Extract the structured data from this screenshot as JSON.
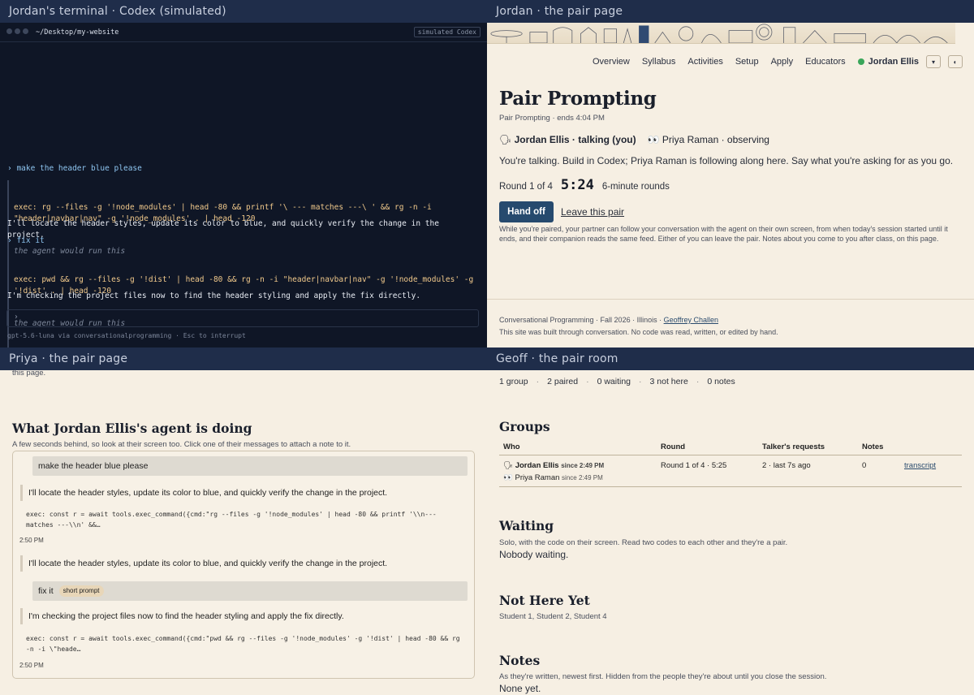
{
  "terminal": {
    "window_title": "Jordan's terminal · Codex (simulated)",
    "path": "~/Desktop/my-website",
    "badge": "simulated Codex",
    "lines": [
      {
        "kind": "prompt",
        "text": "› make the header blue please"
      },
      {
        "kind": "exec",
        "cmd": "exec: rg --files -g '!node_modules' | head -80 && printf '\\ --- matches ---\\ ' && rg -n -i \"header|navbar|nav\" -g '!node_modules' . | head -120",
        "note": "the agent would run this"
      },
      {
        "kind": "say",
        "text": "I'll locate the header styles, update its color to blue, and quickly verify the change in the project."
      },
      {
        "kind": "prompt",
        "text": "› fix it"
      },
      {
        "kind": "exec",
        "cmd": "exec: pwd && rg --files -g '!dist' | head -80 && rg -n -i \"header|navbar|nav\" -g '!node_modules' -g '!dist' . | head -120",
        "note": "the agent would run this"
      },
      {
        "kind": "say",
        "text": "I'm checking the project files now to find the header styling and apply the fix directly."
      }
    ],
    "input_prompt": "›",
    "status": "gpt-5.6-luna via conversationalprogramming  ·  Esc to interrupt"
  },
  "jordan_page": {
    "window_title": "Jordan · the pair page",
    "nav": [
      "Overview",
      "Syllabus",
      "Activities",
      "Setup",
      "Apply",
      "Educators"
    ],
    "user_name": "Jordan Ellis",
    "title": "Pair Prompting",
    "subtitle": "Pair Prompting · ends 4:04 PM",
    "talker": "Jordan Ellis · talking (you)",
    "observer": "Priya Raman · observing",
    "instruction": "You're talking. Build in Codex; Priya Raman is following along here. Say what you're asking for as you go.",
    "round_label": "Round 1 of 4",
    "timer": "5:24",
    "round_length": "6-minute rounds",
    "handoff_label": "Hand off",
    "leave_label": "Leave this pair",
    "fine_print": "While you're paired, your partner can follow your conversation with the agent on their own screen, from when today's session started until it ends, and their companion reads the same feed. Either of you can leave the pair. Notes about you come to you after class, on this page.",
    "footer_course": "Conversational Programming  ·  Fall 2026  ·  Illinois  ·",
    "footer_author": "Geoffrey Challen",
    "footer_note": "This site was built through conversation. No code was read, written, or edited by hand."
  },
  "priya_page": {
    "window_title": "Priya · the pair page",
    "cut_text": "this page.",
    "heading": "What Jordan Ellis's agent is doing",
    "subheading": "A few seconds behind, so look at their screen too. Click one of their messages to attach a note to it.",
    "feed": {
      "user_msg_1": "make the header blue please",
      "agent_msg_1": "I'll locate the header styles, update its color to blue, and quickly verify the change in the project.",
      "code_1": "exec: const r = await tools.exec_command({cmd:\"rg --files -g '!node_modules' | head -80 && printf '\\\\n---\nmatches ---\\\\n' &&…",
      "time_1": "2:50 PM",
      "agent_msg_2": "I'll locate the header styles, update its color to blue, and quickly verify the change in the project.",
      "user_msg_2": "fix it",
      "user_msg_2_tag": "short prompt",
      "agent_msg_3": "I'm checking the project files now to find the header styling and apply the fix directly.",
      "code_2": "exec: const r = await tools.exec_command({cmd:\"pwd && rg --files -g '!node_modules' -g '!dist' | head -80 && rg\n-n -i \\\"heade…",
      "time_2": "2:50 PM"
    }
  },
  "geoff_room": {
    "window_title": "Geoff · the pair room",
    "stats": [
      "1 group",
      "2 paired",
      "0 waiting",
      "3 not here",
      "0 notes"
    ],
    "groups_heading": "Groups",
    "columns": [
      "Who",
      "Round",
      "Talker's requests",
      "Notes"
    ],
    "row": {
      "talker": "Jordan Ellis",
      "talker_since": "since 2:49 PM",
      "observer": "Priya Raman",
      "observer_since": "since 2:49 PM",
      "round": "Round 1 of 4 · 5:25",
      "requests": "2 · last 7s ago",
      "notes": "0",
      "link": "transcript"
    },
    "waiting_heading": "Waiting",
    "waiting_sub": "Solo, with the code on their screen. Read two codes to each other and they're a pair.",
    "waiting_body": "Nobody waiting.",
    "nothere_heading": "Not Here Yet",
    "nothere_list": "Student 1, Student 2, Student 4",
    "notes_heading": "Notes",
    "notes_sub": "As they're written, newest first. Hidden from the people they're about until you close the session.",
    "notes_body": "None yet."
  }
}
